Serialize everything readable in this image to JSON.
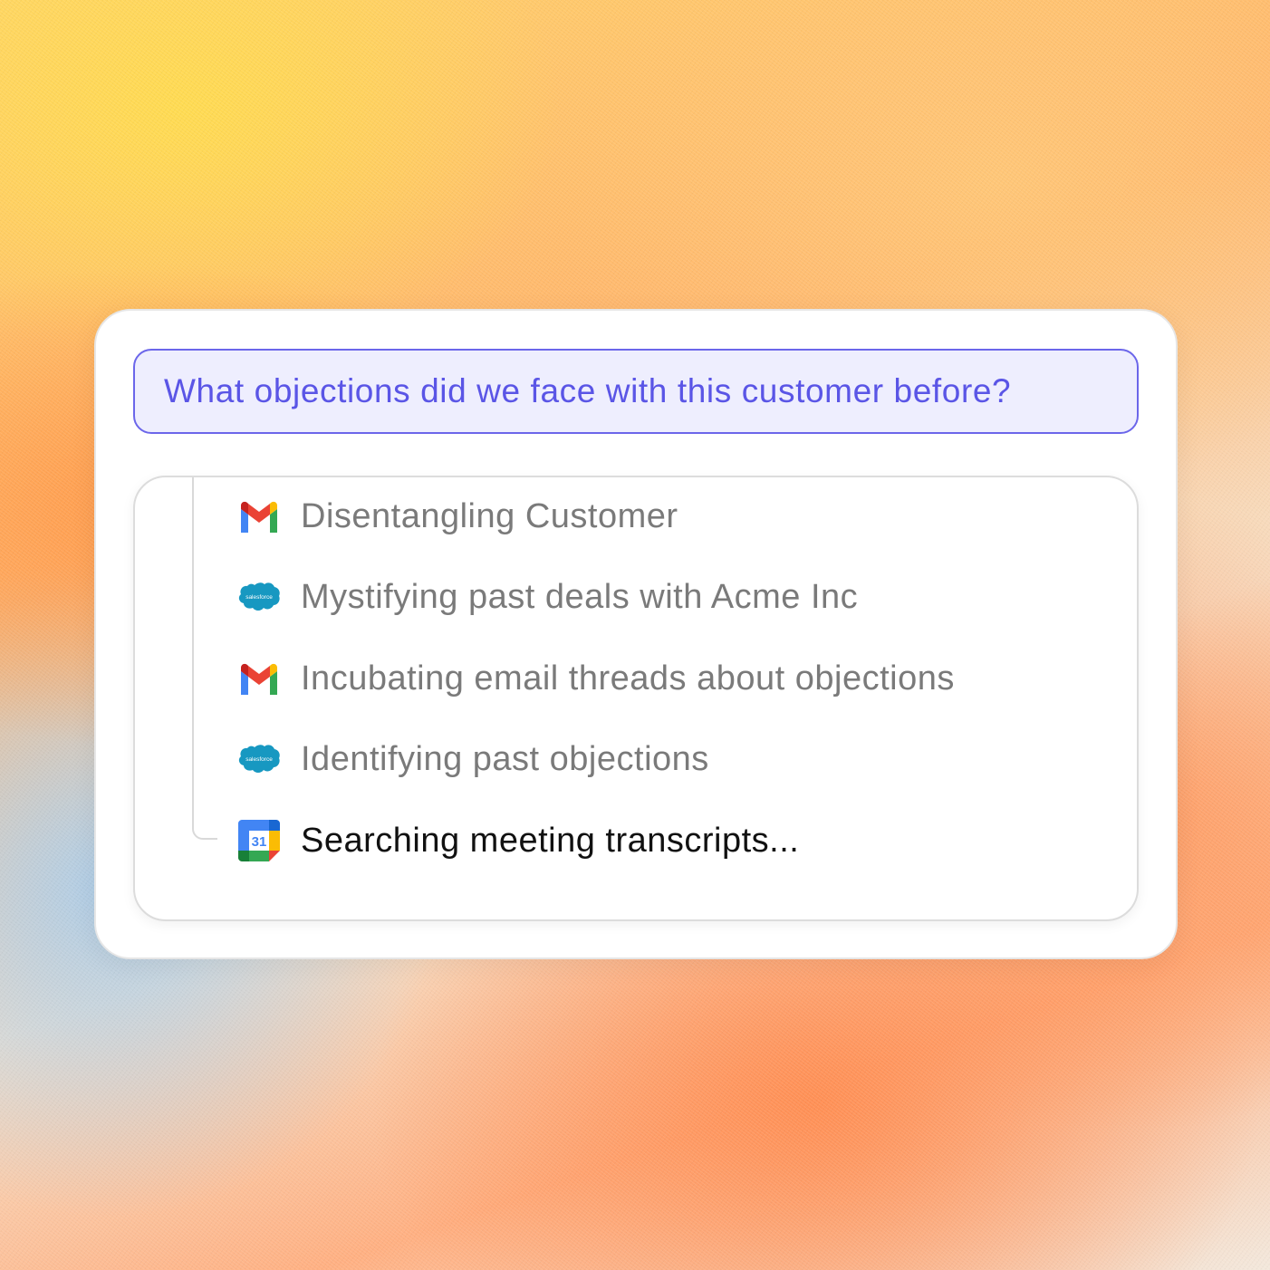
{
  "query": {
    "text": "What objections did we face with this customer before?"
  },
  "steps": [
    {
      "icon": "gmail-icon",
      "label": "Disentangling Customer",
      "active": false
    },
    {
      "icon": "salesforce-icon",
      "icon_text": "salesforce",
      "label": "Mystifying past deals with Acme Inc",
      "active": false
    },
    {
      "icon": "gmail-icon",
      "label": "Incubating email threads about objections",
      "active": false
    },
    {
      "icon": "salesforce-icon",
      "icon_text": "salesforce",
      "label": "Identifying past objections",
      "active": false
    },
    {
      "icon": "google-calendar-icon",
      "icon_text": "31",
      "label": "Searching meeting transcripts...",
      "active": true
    }
  ],
  "colors": {
    "query_text": "#5a55e6",
    "query_border": "#6b66ea",
    "query_bg": "#eeeefe",
    "step_inactive": "#7a7a7a",
    "step_active": "#111111"
  }
}
